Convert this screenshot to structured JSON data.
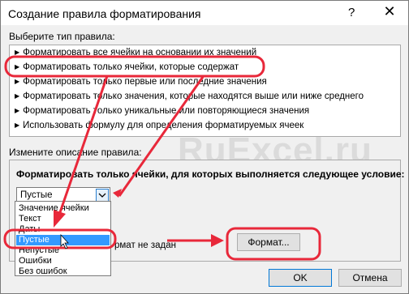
{
  "window": {
    "title": "Создание правила форматирования",
    "help": "?",
    "close": "✕"
  },
  "rule_type": {
    "label": "Выберите тип правила:",
    "items": [
      "Форматировать все ячейки на основании их значений",
      "Форматировать только ячейки, которые содержат",
      "Форматировать только первые или последние значения",
      "Форматировать только значения, которые находятся выше или ниже среднего",
      "Форматировать только уникальные или повторяющиеся значения",
      "Использовать формулу для определения форматируемых ячеек"
    ]
  },
  "description": {
    "label": "Измените описание правила:",
    "heading": "Форматировать только ячейки, для которых выполняется следующее условие:",
    "combo_value": "Пустые",
    "dropdown_options": [
      "Значение ячейки",
      "Текст",
      "Даты",
      "Пустые",
      "Непустые",
      "Ошибки",
      "Без ошибок"
    ],
    "preview_text": "рмат не задан",
    "format_button": "Формат..."
  },
  "buttons": {
    "ok": "OK",
    "cancel": "Отмена"
  },
  "watermark": "RuExcel.ru",
  "colors": {
    "annotation": "#e8283a",
    "selection": "#3399ff"
  }
}
